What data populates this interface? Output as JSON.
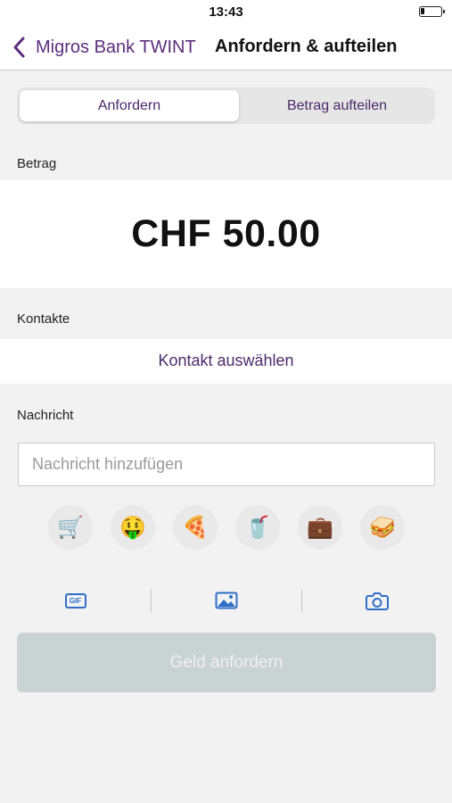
{
  "status_bar": {
    "time": "13:43",
    "battery_level": 0.2
  },
  "nav": {
    "back_label": "Migros Bank TWINT",
    "title": "Anfordern & aufteilen"
  },
  "tabs": [
    {
      "label": "Anfordern",
      "active": true
    },
    {
      "label": "Betrag aufteilen",
      "active": false
    }
  ],
  "amount": {
    "label": "Betrag",
    "value": "CHF 50.00"
  },
  "contacts": {
    "label": "Kontakte",
    "select_label": "Kontakt auswählen"
  },
  "message": {
    "label": "Nachricht",
    "placeholder": "Nachricht hinzufügen",
    "value": ""
  },
  "emojis": [
    {
      "icon": "shopping-cart-icon",
      "glyph": "🛒"
    },
    {
      "icon": "money-mouth-face-icon",
      "glyph": "🤑"
    },
    {
      "icon": "pizza-icon",
      "glyph": "🍕"
    },
    {
      "icon": "drink-cup-icon",
      "glyph": "🥤"
    },
    {
      "icon": "suitcase-icon",
      "glyph": "💼"
    },
    {
      "icon": "sandwich-icon",
      "glyph": "🥪"
    }
  ],
  "media": {
    "gif_label": "GIF",
    "icons": [
      "gif-icon",
      "image-icon",
      "camera-icon"
    ],
    "accent_color": "#2f6fc9"
  },
  "action": {
    "label": "Geld anfordern",
    "enabled": false
  },
  "colors": {
    "brand": "#5b2d7c",
    "button_disabled": "#c9d3d1"
  }
}
